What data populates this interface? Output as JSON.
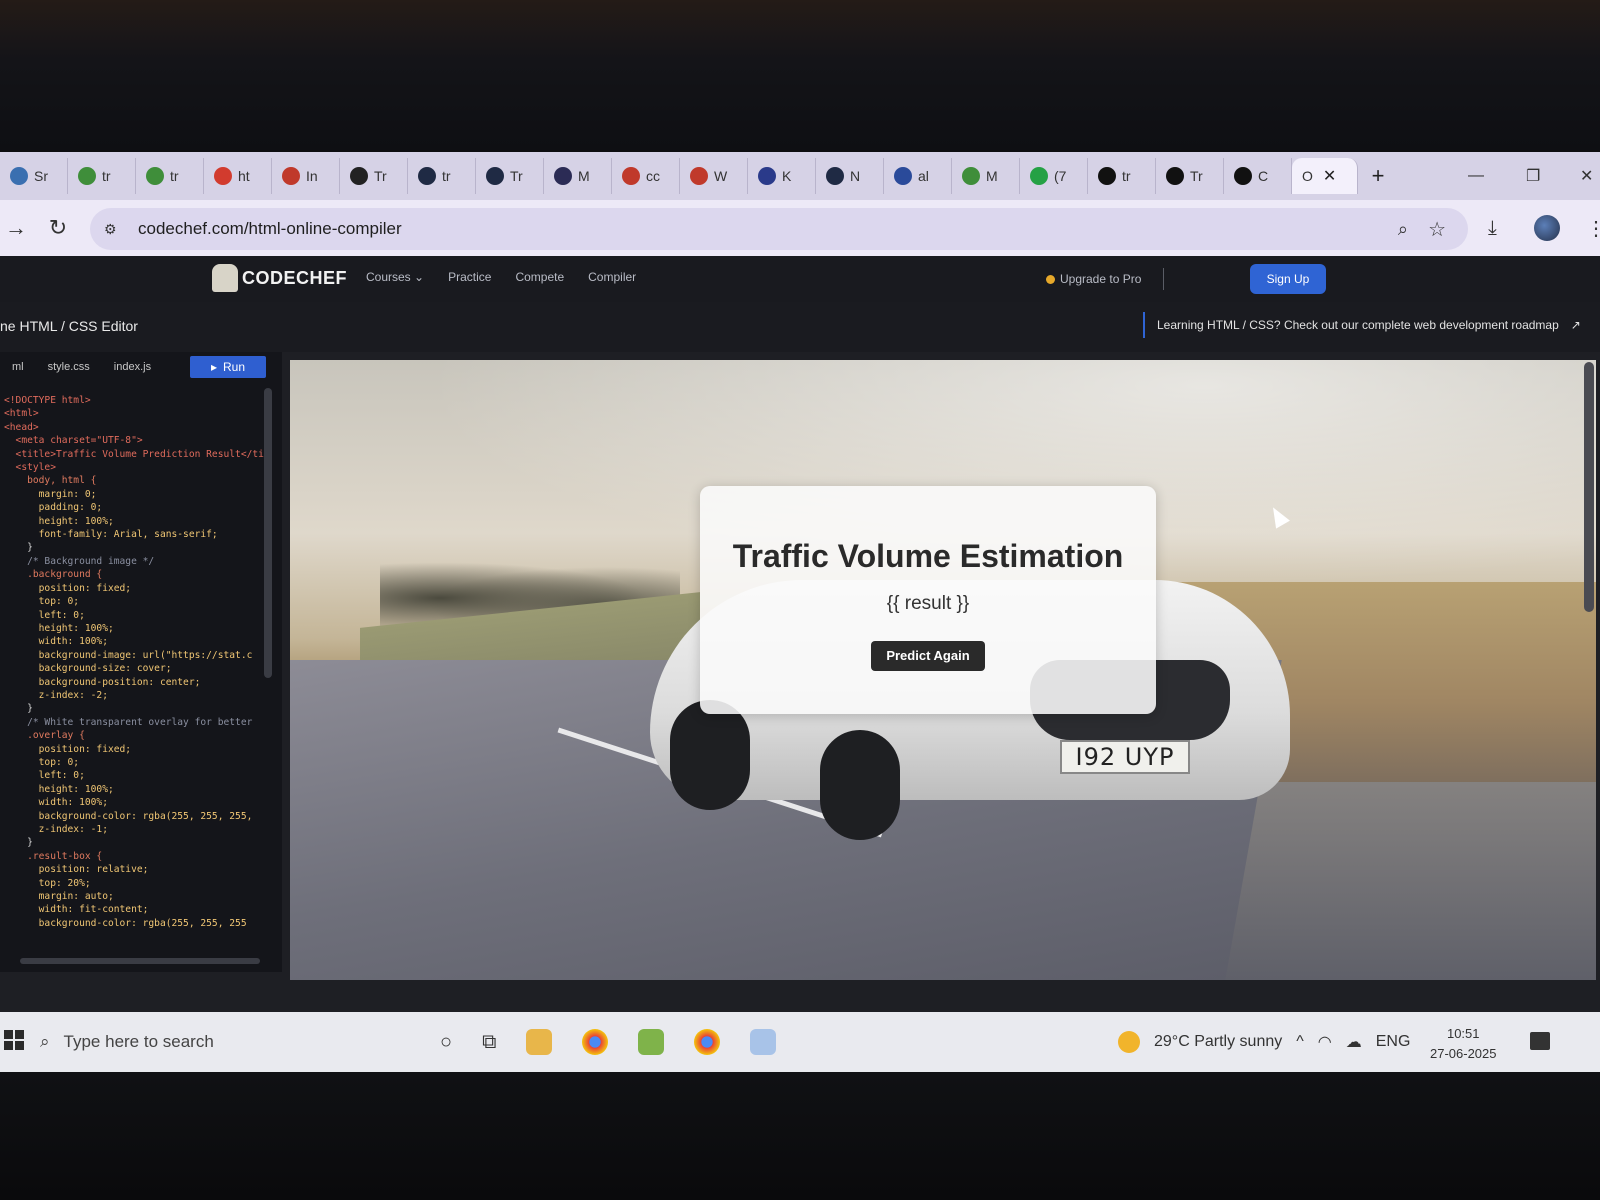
{
  "browser": {
    "tabs": [
      {
        "label": "Sr",
        "color": "#3a6fb0"
      },
      {
        "label": "tr",
        "color": "#3f8e3a"
      },
      {
        "label": "tr",
        "color": "#3f8e3a"
      },
      {
        "label": "ht",
        "color": "#d23b2e"
      },
      {
        "label": "In",
        "color": "#c0392b"
      },
      {
        "label": "Tr",
        "color": "#222222"
      },
      {
        "label": "tr",
        "color": "#1f2a44"
      },
      {
        "label": "Tr",
        "color": "#1f2a44"
      },
      {
        "label": "M",
        "color": "#2b2b55"
      },
      {
        "label": "cc",
        "color": "#c0392b"
      },
      {
        "label": "W",
        "color": "#c0392b"
      },
      {
        "label": "K",
        "color": "#2a3a8a"
      },
      {
        "label": "N",
        "color": "#1f2a44"
      },
      {
        "label": "al",
        "color": "#2a4a9a"
      },
      {
        "label": "M",
        "color": "#3f8e3a"
      },
      {
        "label": "(7",
        "color": "#25a145"
      },
      {
        "label": "tr",
        "color": "#111111"
      },
      {
        "label": "Tr",
        "color": "#111111"
      },
      {
        "label": "C",
        "color": "#111111"
      }
    ],
    "active_tab": {
      "label": "O",
      "close": "✕"
    },
    "new_tab": "+",
    "url": "codechef.com/html-online-compiler"
  },
  "codechef": {
    "logo_text": "CODECHEF",
    "nav": [
      "Courses ⌄",
      "Practice",
      "Compete",
      "Compiler"
    ],
    "upgrade": "Upgrade to Pro",
    "signup": "Sign Up",
    "editor_title": "ne HTML / CSS Editor",
    "roadmap": "Learning HTML / CSS? Check out our complete web development roadmap",
    "roadmap_arrow": "↗"
  },
  "editor": {
    "tabs": [
      "ml",
      "style.css",
      "index.js"
    ],
    "run": "Run",
    "code_lines": [
      "<!DOCTYPE html>",
      "<html>",
      "<head>",
      "  <meta charset=\"UTF-8\">",
      "  <title>Traffic Volume Prediction Result</title>",
      "  <style>",
      "    body, html {",
      "      margin: 0;",
      "      padding: 0;",
      "      height: 100%;",
      "      font-family: Arial, sans-serif;",
      "    }",
      "",
      "    /* Background image */",
      "    .background {",
      "      position: fixed;",
      "      top: 0;",
      "      left: 0;",
      "      height: 100%;",
      "      width: 100%;",
      "      background-image: url(\"https://stat.c",
      "      background-size: cover;",
      "      background-position: center;",
      "      z-index: -2;",
      "    }",
      "",
      "    /* White transparent overlay for better",
      "    .overlay {",
      "      position: fixed;",
      "      top: 0;",
      "      left: 0;",
      "      height: 100%;",
      "      width: 100%;",
      "      background-color: rgba(255, 255, 255,",
      "      z-index: -1;",
      "    }",
      "",
      "    .result-box {",
      "      position: relative;",
      "      top: 20%;",
      "      margin: auto;",
      "      width: fit-content;",
      "      background-color: rgba(255, 255, 255"
    ]
  },
  "preview": {
    "title": "Traffic Volume Estimation",
    "result": "{{ result }}",
    "button": "Predict Again",
    "plate": "I92 UYP"
  },
  "taskbar": {
    "search_placeholder": "Type here to search",
    "weather": "29°C  Partly sunny",
    "lang": "ENG",
    "time": "10:51",
    "date": "27-06-2025"
  }
}
